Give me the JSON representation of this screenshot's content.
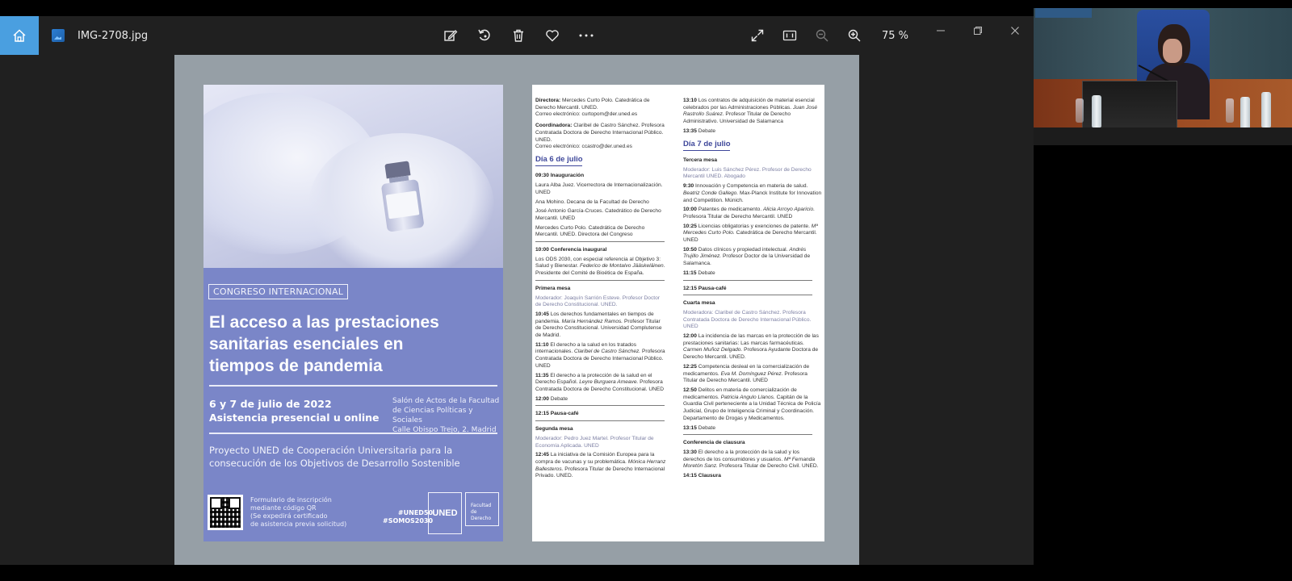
{
  "viewer": {
    "file_name": "IMG-2708.jpg",
    "zoom": "75 %",
    "tools": [
      "edit-icon",
      "rotate-icon",
      "delete-icon",
      "favorite-icon",
      "more-icon"
    ],
    "right_tools": [
      "fullscreen-icon",
      "actual-size-icon",
      "zoom-out-icon",
      "zoom-in-icon"
    ]
  },
  "poster": {
    "tag": "CONGRESO INTERNACIONAL",
    "title_lines": [
      "El acceso a las prestaciones",
      "sanitarias esenciales en",
      "tiempos de pandemia"
    ],
    "date_line1": "6 y 7 de julio de 2022",
    "date_line2": "Asistencia presencial u online",
    "venue_lines": [
      "Salón de Actos de la Facultad",
      "de Ciencias Políticas y Sociales",
      "Calle Obispo Trejo, 2. Madrid"
    ],
    "project_lines": [
      "Proyecto UNED de Cooperación Universitaria para la",
      "consecución de los Objetivos de Desarrollo Sostenible"
    ],
    "form_lines": [
      "Formulario de inscripción",
      "mediante código QR",
      "(Se expedirá certificado",
      "de asistencia previa solicitud)"
    ],
    "hashtags": [
      "#UNED50",
      "#SOMOS2030"
    ],
    "uned_logo": "UNED",
    "faculty_logo_lines": [
      "Facultad",
      "de Derecho"
    ]
  },
  "program": {
    "direction": {
      "directora_label": "Directora:",
      "directora": "Mercedes Curto Polo. Catedrática de Derecho Mercantil. UNED.",
      "directora_email": "Correo electrónico: curtopom@der.uned.es",
      "coordinadora_label": "Coordinadora:",
      "coordinadora": "Claribel de Castro Sánchez. Profesora Contratada Doctora de Derecho Internacional Público. UNED.",
      "coordinadora_email": "Correo electrónico: ccastro@der.uned.es"
    },
    "day1": {
      "title": "Día 6 de julio",
      "inauguracion_time": "09:30",
      "inauguracion": "Inauguración",
      "speakers": [
        "Laura Alba Juez. Vicerrectora de Internacionalización. UNED",
        "Ana Mohino. Decana de la Facultad de Derecho",
        "José Antonio García-Cruces. Catedrático de Derecho Mercantil. UNED",
        "Mercedes Curto Polo. Catedrática de Derecho Mercantil. UNED. Directora del Congreso"
      ],
      "conf_time": "10:00",
      "conf_title": "Conferencia inaugural",
      "conf_text": "Los ODS 2030, con especial referencia al Objetivo 3: Salud y Bienestar.",
      "conf_speaker": "Federico de Montalvo Jääskeläinen.",
      "conf_speaker_role": "Presidente del Comité de Bioética de España.",
      "mesa1_title": "Primera mesa",
      "mesa1_mod": "Moderador: Joaquín Sarrión Esteve. Profesor Doctor de Derecho Constitucional. UNED.",
      "mesa1_items": [
        {
          "time": "10:45",
          "text": "Los derechos fundamentales en tiempos de pandemia.",
          "speaker": "María Hernández Ramos.",
          "role": "Profesor Titular de Derecho Constitucional. Universidad Complutense de Madrid."
        },
        {
          "time": "11:10",
          "text": "El derecho a la salud en los tratados internacionales.",
          "speaker": "Claribel de Castro Sánchez.",
          "role": "Profesora Contratada Doctora de Derecho Internacional Público. UNED"
        },
        {
          "time": "11:35",
          "text": "El derecho a la protección de la salud en el Derecho Español.",
          "speaker": "Leyre Burguera Ameave.",
          "role": "Profesora Contratada Doctora de Derecho Constitucional. UNED"
        }
      ],
      "debate1_time": "12:00",
      "debate_label": "Debate",
      "pausa1_time": "12:15",
      "pausa_label": "Pausa-café",
      "mesa2_title": "Segunda mesa",
      "mesa2_mod": "Moderador: Pedro Juez Martel. Profesor Titular de Economía Aplicada. UNED",
      "mesa2_item": {
        "time": "12:45",
        "text": "La iniciativa de la Comisión Europea para la compra de vacunas y su problemática.",
        "speaker": "Mónica Herranz Ballesteros.",
        "role": "Profesora Titular de Derecho Internacional Privado. UNED."
      }
    },
    "right_col": {
      "item_1310": {
        "time": "13:10",
        "text": "Los contratos de adquisición de material esencial celebrados por las Administraciones Públicas.",
        "speaker": "Juan José Rastrollo Suárez.",
        "role": "Profesor Titular de Derecho Administrativo. Universidad de Salamanca"
      },
      "debate_1335": "13:35",
      "day2_title": "Día 7 de julio",
      "mesa3_title": "Tercera mesa",
      "mesa3_mod": "Moderador: Luis Sánchez Pérez. Profesor de Derecho Mercantil UNED. Abogado",
      "mesa3_items": [
        {
          "time": "9:30",
          "text": "Innovación y Competencia en materia de salud.",
          "speaker": "Beatriz Conde Gallego.",
          "role": "Max-Planck Institute for Innovation and Competition. Múnich."
        },
        {
          "time": "10:00",
          "text": "Patentes de medicamento.",
          "speaker": "Alicia Arroyo Aparicio.",
          "role": "Profesora Titular de Derecho Mercantil. UNED"
        },
        {
          "time": "10:25",
          "text": "Licencias obligatorias y exenciones de patente.",
          "speaker": "Mª Mercedes Curto Polo.",
          "role": "Catedrática de Derecho Mercantil. UNED"
        },
        {
          "time": "10:50",
          "text": "Datos clínicos y propiedad intelectual.",
          "speaker": "Andrés Trujillo Jiménez.",
          "role": "Profesor Doctor de la Universidad de Salamanca."
        }
      ],
      "debate_1115": "11:15",
      "pausa_1215": "12:15",
      "mesa4_title": "Cuarta mesa",
      "mesa4_mod": "Moderadora: Claribel de Castro Sánchez. Profesora Contratada Doctora de Derecho Internacional Público. UNED",
      "mesa4_items": [
        {
          "time": "12:00",
          "text": "La incidencia de las marcas en la protección de las prestaciones sanitarias: Las marcas farmacéuticas.",
          "speaker": "Carmen Muñoz Delgado.",
          "role": "Profesora Ayudante Doctora de Derecho Mercantil. UNED."
        },
        {
          "time": "12:25",
          "text": "Competencia desleal en la comercialización de medicamentos.",
          "speaker": "Eva M. Domínguez Pérez.",
          "role": "Profesora Titular de Derecho Mercantil. UNED"
        },
        {
          "time": "12:50",
          "text": "Delitos en materia de comercialización de medicamentos.",
          "speaker": "Patricia Angulo Llanos.",
          "role": "Capitán de la Guardia Civil perteneciente a la Unidad Técnica de Policía Judicial, Grupo de Inteligencia Criminal y Coordinación. Departamento de Drogas y Medicamentos."
        }
      ],
      "debate_1315": "13:15",
      "clausura_title": "Conferencia de clausura",
      "clausura_item": {
        "time": "13:30",
        "text": "El derecho a la protección de la salud y los derechos de los consumidores y usuarios.",
        "speaker": "Mª Fernanda Moretón Sanz.",
        "role": "Profesora Titular de Derecho Civil. UNED."
      },
      "clausura_time": "14:15",
      "clausura_label": "Clausura"
    }
  }
}
